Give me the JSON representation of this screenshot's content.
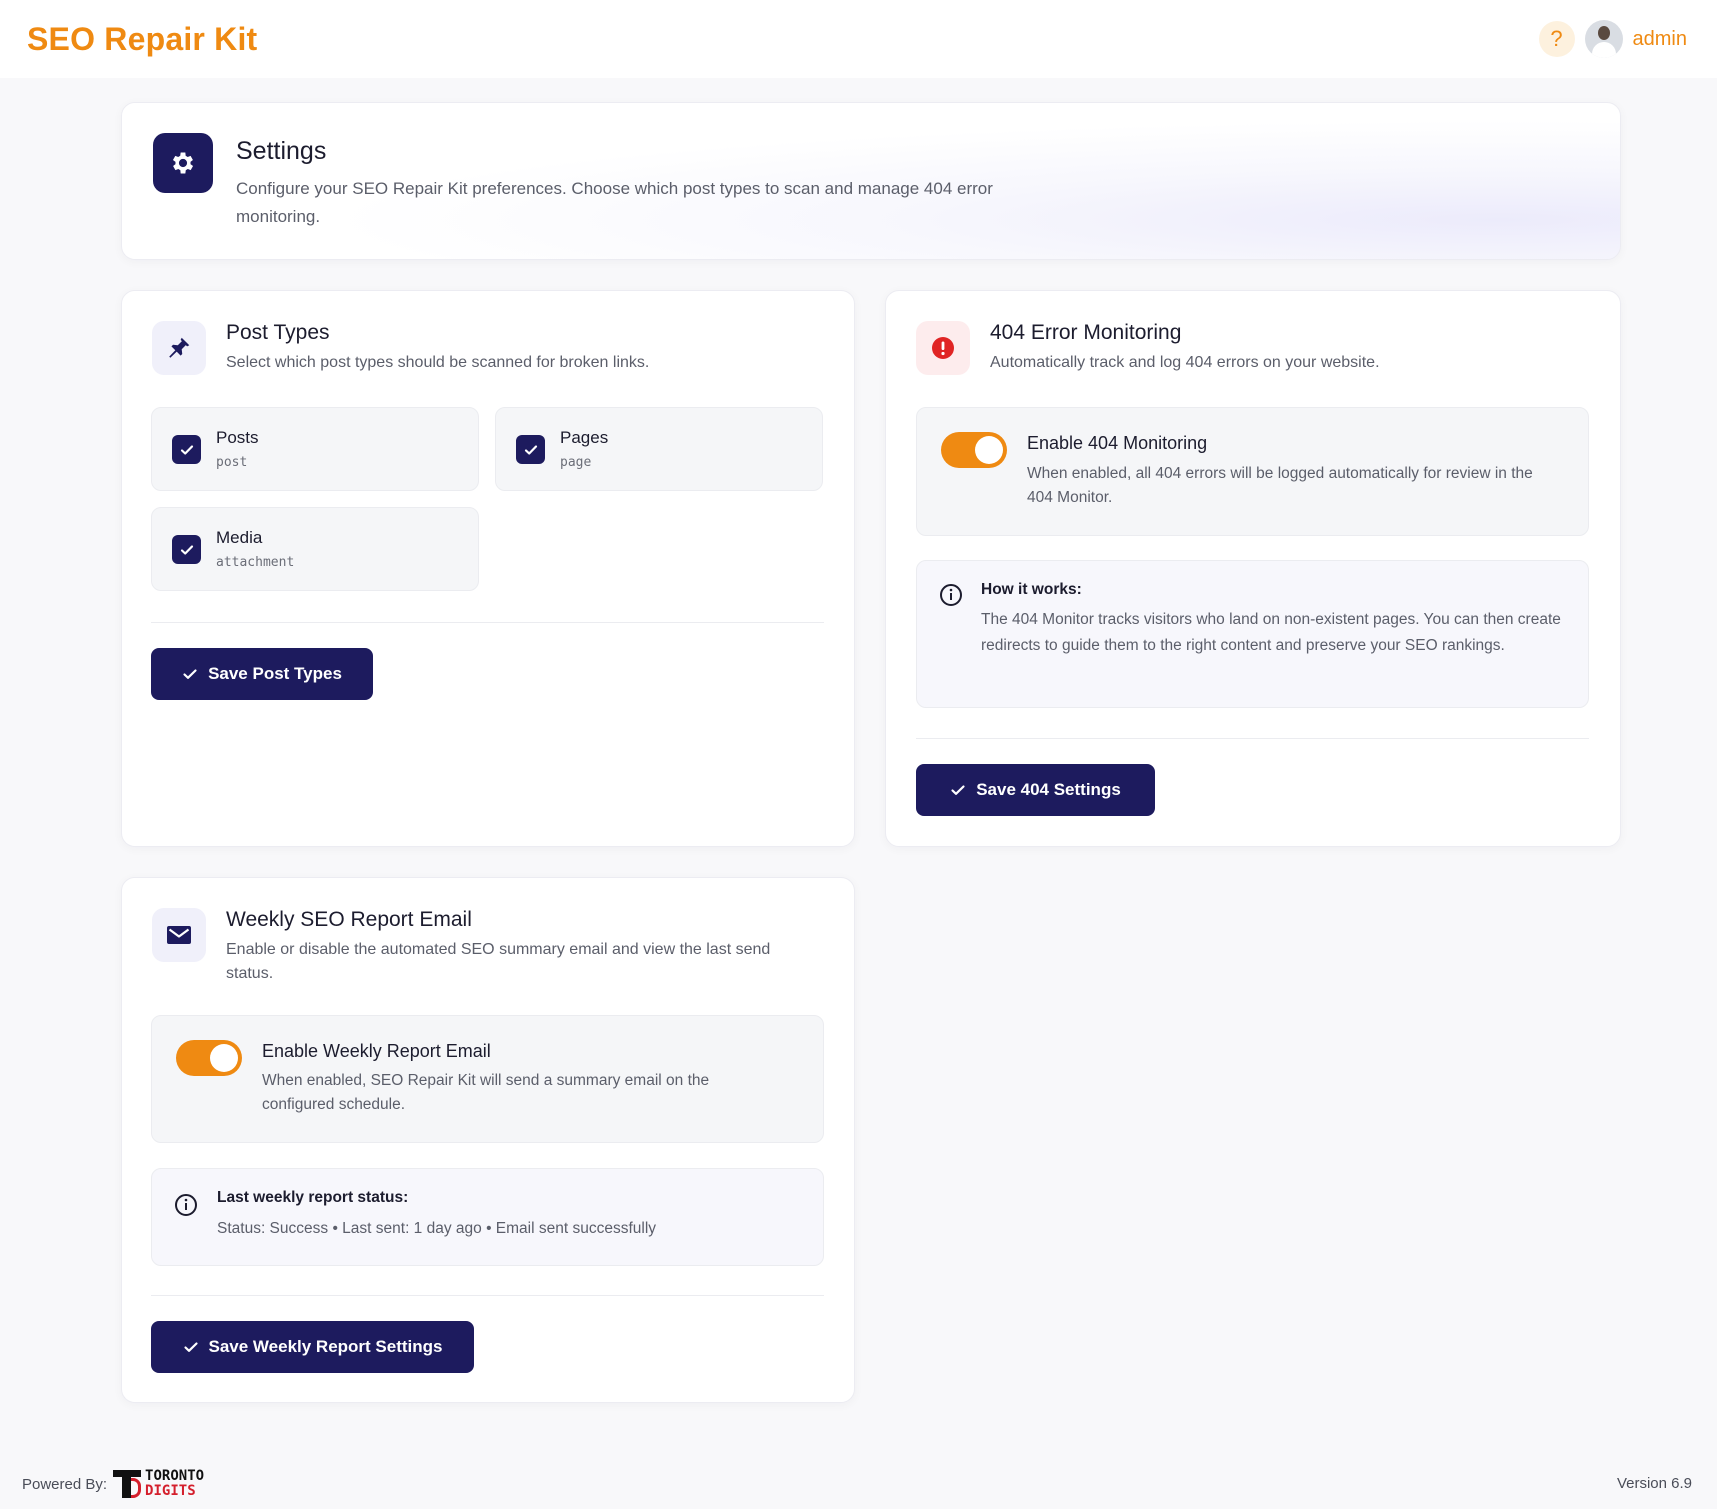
{
  "app": {
    "title": "SEO Repair Kit",
    "help_icon": "?",
    "user_name": "admin",
    "accent_color": "#ef8a12",
    "primary_color": "#1d1b5e"
  },
  "hero": {
    "title": "Settings",
    "description": "Configure your SEO Repair Kit preferences. Choose which post types to scan and manage 404 error monitoring."
  },
  "post_types": {
    "title": "Post Types",
    "description": "Select which post types should be scanned for broken links.",
    "items": [
      {
        "label": "Posts",
        "slug": "post",
        "checked": true
      },
      {
        "label": "Pages",
        "slug": "page",
        "checked": true
      },
      {
        "label": "Media",
        "slug": "attachment",
        "checked": true
      }
    ],
    "save_label": "Save Post Types"
  },
  "monitoring": {
    "title": "404 Error Monitoring",
    "description": "Automatically track and log 404 errors on your website.",
    "toggle_title": "Enable 404 Monitoring",
    "toggle_desc": "When enabled, all 404 errors will be logged automatically for review in the 404 Monitor.",
    "toggle_on": true,
    "info_title": "How it works:",
    "info_text": "The 404 Monitor tracks visitors who land on non-existent pages. You can then create redirects to guide them to the right content and preserve your SEO rankings.",
    "save_label": "Save 404 Settings"
  },
  "weekly": {
    "title": "Weekly SEO Report Email",
    "description": "Enable or disable the automated SEO summary email and view the last send status.",
    "toggle_title": "Enable Weekly Report Email",
    "toggle_desc": "When enabled, SEO Repair Kit will send a summary email on the configured schedule.",
    "toggle_on": true,
    "status_title": "Last weekly report status:",
    "status_text": "Status: Success • Last sent: 1 day ago • Email sent successfully",
    "save_label": "Save Weekly Report Settings"
  },
  "footer": {
    "powered_by": "Powered By:",
    "logo_line1": "TORONTO",
    "logo_line2": "DIGITS",
    "version": "Version 6.9"
  }
}
